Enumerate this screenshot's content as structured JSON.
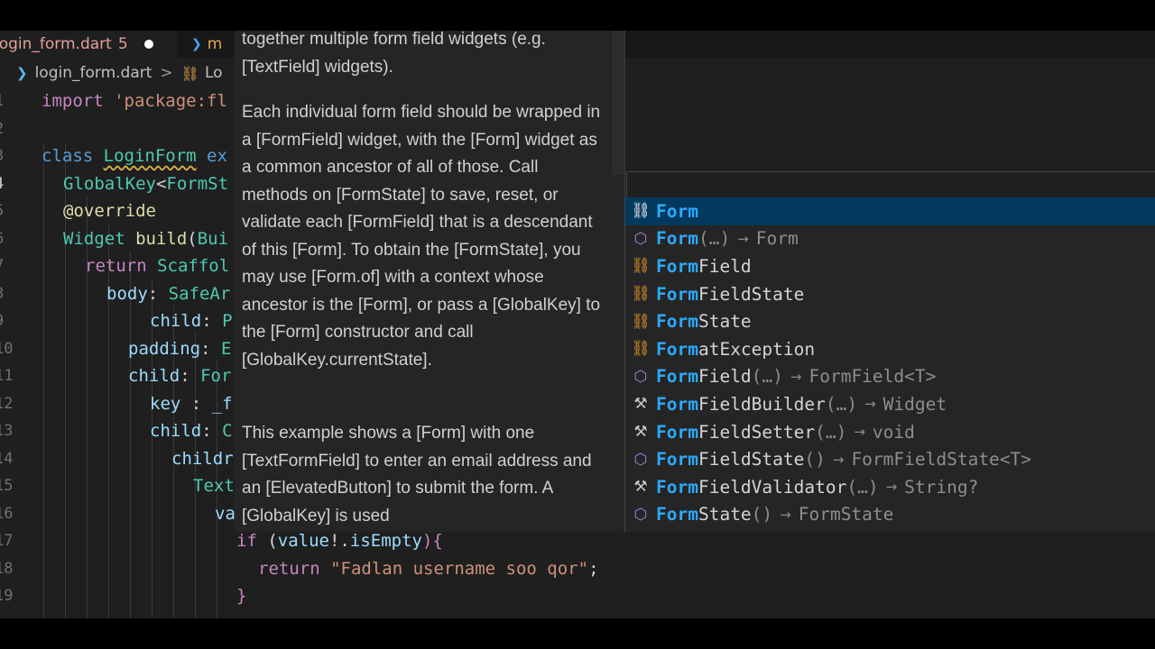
{
  "tabs": {
    "active": {
      "label": "login_form.dart",
      "count": "5"
    },
    "second": {
      "label": "m"
    }
  },
  "breadcrumb": {
    "file": "login_form.dart",
    "separator": ">",
    "symbol": "Lo"
  },
  "editor": {
    "lines": [
      {
        "num": "1",
        "tokens": [
          {
            "t": "import ",
            "c": "kw2"
          },
          {
            "t": "'package:fl",
            "c": "str"
          }
        ]
      },
      {
        "num": "2",
        "tokens": []
      },
      {
        "num": "3",
        "tokens": [
          {
            "t": "class ",
            "c": "kw"
          },
          {
            "t": "LoginForm",
            "c": "ty squig"
          },
          {
            "t": " ex",
            "c": "kw"
          }
        ]
      },
      {
        "num": "4",
        "tokens": [
          {
            "t": "GlobalKey",
            "c": "ty"
          },
          {
            "t": "<",
            "c": ""
          },
          {
            "t": "FormSt",
            "c": "ty"
          }
        ]
      },
      {
        "num": "5",
        "tokens": [
          {
            "t": "@override",
            "c": "fn"
          }
        ]
      },
      {
        "num": "6",
        "tokens": [
          {
            "t": "Widget ",
            "c": "ty"
          },
          {
            "t": "build",
            "c": "fn"
          },
          {
            "t": "(",
            "c": ""
          },
          {
            "t": "Bui",
            "c": "ty"
          }
        ]
      },
      {
        "num": "7",
        "tokens": [
          {
            "t": "return ",
            "c": "kw2"
          },
          {
            "t": "Scaffol",
            "c": "ty"
          }
        ]
      },
      {
        "num": "8",
        "tokens": [
          {
            "t": "body",
            "c": "prop"
          },
          {
            "t": ": ",
            "c": ""
          },
          {
            "t": "SafeAr",
            "c": "ty"
          }
        ]
      },
      {
        "num": "9",
        "tokens": [
          {
            "t": "child",
            "c": "prop"
          },
          {
            "t": ": ",
            "c": ""
          },
          {
            "t": "P",
            "c": "ty"
          }
        ]
      },
      {
        "num": "10",
        "tokens": [
          {
            "t": "padding",
            "c": "prop"
          },
          {
            "t": ": ",
            "c": ""
          },
          {
            "t": "E",
            "c": "ty"
          }
        ]
      },
      {
        "num": "11",
        "tokens": [
          {
            "t": "child",
            "c": "prop"
          },
          {
            "t": ": ",
            "c": ""
          },
          {
            "t": "For",
            "c": "ty"
          }
        ]
      },
      {
        "num": "12",
        "tokens": [
          {
            "t": "key",
            "c": "prop"
          },
          {
            "t": " : ",
            "c": ""
          },
          {
            "t": "_f",
            "c": "prop"
          }
        ]
      },
      {
        "num": "13",
        "tokens": [
          {
            "t": "child",
            "c": "prop"
          },
          {
            "t": ": ",
            "c": ""
          },
          {
            "t": "C",
            "c": "ty"
          }
        ]
      },
      {
        "num": "14",
        "tokens": [
          {
            "t": "childr",
            "c": "prop"
          }
        ]
      },
      {
        "num": "15",
        "tokens": [
          {
            "t": "Text",
            "c": "ty"
          }
        ]
      },
      {
        "num": "16",
        "tokens": [
          {
            "t": "va",
            "c": "prop"
          }
        ]
      },
      {
        "num": "17",
        "tokens": [
          {
            "t": "if ",
            "c": "kw2"
          },
          {
            "t": "(",
            "c": ""
          },
          {
            "t": "value",
            "c": "prop"
          },
          {
            "t": "!.",
            "c": ""
          },
          {
            "t": "isEmpty",
            "c": "prop"
          },
          {
            "t": "){",
            "c": "kw2"
          }
        ]
      },
      {
        "num": "18",
        "tokens": [
          {
            "t": "return ",
            "c": "kw2"
          },
          {
            "t": "\"Fadlan username soo qor\"",
            "c": "str"
          },
          {
            "t": ";",
            "c": ""
          }
        ]
      },
      {
        "num": "19",
        "tokens": [
          {
            "t": "}",
            "c": "kw2"
          }
        ]
      }
    ]
  },
  "hover_doc": {
    "paragraphs": [
      "together multiple form field widgets (e.g. [TextField] widgets).",
      "Each individual form field should be wrapped in a [FormField] widget, with the [Form] widget as a common ancestor of all of those. Call methods on [FormState] to save, reset, or validate each [FormField] that is a descendant of this [Form]. To obtain the [FormState], you may use [Form.of] with a context whose ancestor is the [Form], or pass a [GlobalKey] to the [Form] constructor and call [GlobalKey.currentState].",
      "This example shows a [Form] with one [TextFormField] to enter an email address and an [ElevatedButton] to submit the form. A [GlobalKey] is used"
    ]
  },
  "suggestions": {
    "items": [
      {
        "icon": "class",
        "match": "Form",
        "rest": "",
        "params": "",
        "type": ""
      },
      {
        "icon": "constructor",
        "match": "Form",
        "rest": "",
        "params": "(…)",
        "type": "Form"
      },
      {
        "icon": "class",
        "match": "Form",
        "rest": "Field",
        "params": "",
        "type": ""
      },
      {
        "icon": "class",
        "match": "Form",
        "rest": "FieldState",
        "params": "",
        "type": ""
      },
      {
        "icon": "class",
        "match": "Form",
        "rest": "State",
        "params": "",
        "type": ""
      },
      {
        "icon": "class",
        "match": "Form",
        "rest": "atException",
        "params": "",
        "type": ""
      },
      {
        "icon": "constructor",
        "match": "Form",
        "rest": "Field",
        "params": "(…)",
        "type": "FormField<T>"
      },
      {
        "icon": "function",
        "match": "Form",
        "rest": "FieldBuilder",
        "params": "(…)",
        "type": "Widget"
      },
      {
        "icon": "function",
        "match": "Form",
        "rest": "FieldSetter",
        "params": "(…)",
        "type": "void"
      },
      {
        "icon": "constructor",
        "match": "Form",
        "rest": "FieldState",
        "params": "()",
        "type": "FormFieldState<T>"
      },
      {
        "icon": "function",
        "match": "Form",
        "rest": "FieldValidator",
        "params": "(…)",
        "type": "String?"
      },
      {
        "icon": "constructor",
        "match": "Form",
        "rest": "State",
        "params": "()",
        "type": "FormState"
      }
    ],
    "selected_index": 0,
    "arrow": "→"
  },
  "icons": {
    "class": "class-icon",
    "constructor": "cube-icon",
    "function": "wrench-icon"
  }
}
